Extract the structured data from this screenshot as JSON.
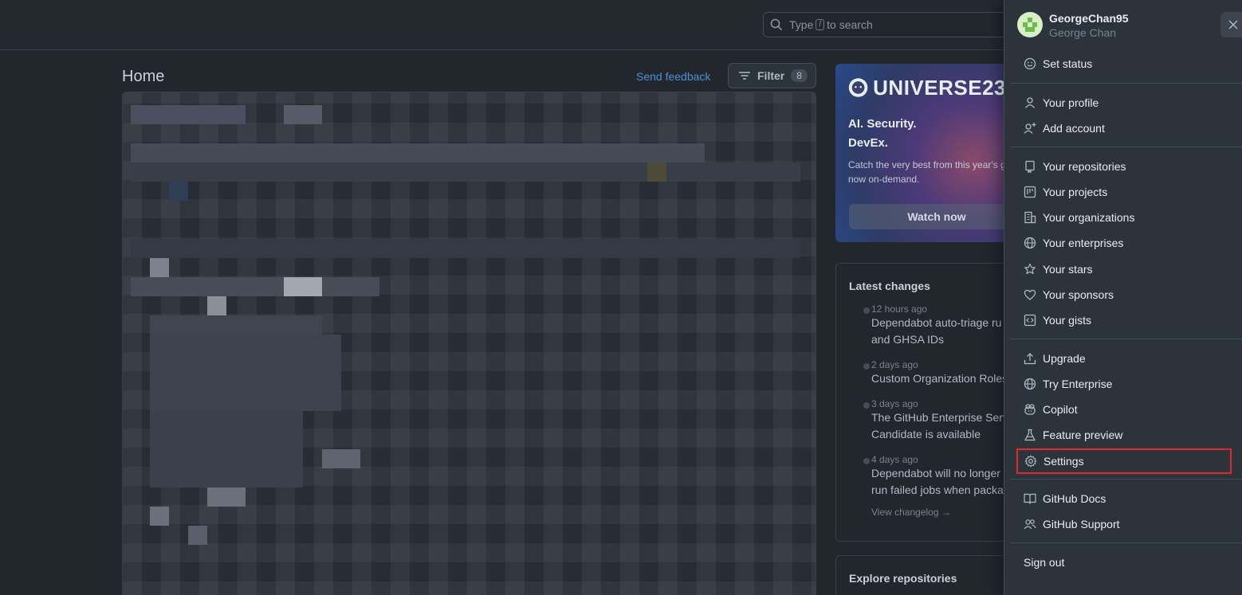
{
  "header": {
    "search_prefix": "Type",
    "search_key": "/",
    "search_suffix": "to search"
  },
  "main": {
    "title": "Home",
    "send_feedback": "Send feedback",
    "filter_label": "Filter",
    "filter_count": "8"
  },
  "promo": {
    "logo_text": "UNIVERSE23",
    "heading_line1": "AI. Security.",
    "heading_line2": "DevEx.",
    "body": "Catch the very best from this year's g now on-demand.",
    "button": "Watch now"
  },
  "latest_changes": {
    "title": "Latest changes",
    "items": [
      {
        "time": "12 hours ago",
        "line1": "Dependabot auto-triage ru",
        "line2": "and GHSA IDs"
      },
      {
        "time": "2 days ago",
        "line1": "Custom Organization Roles",
        "line2": ""
      },
      {
        "time": "3 days ago",
        "line1": "The GitHub Enterprise Serv",
        "line2": "Candidate is available"
      },
      {
        "time": "4 days ago",
        "line1": "Dependabot will no longer",
        "line2": "run failed jobs when packa"
      }
    ],
    "changelog_link": "View changelog →"
  },
  "explore": {
    "title": "Explore repositories"
  },
  "user_menu": {
    "username": "GeorgeChan95",
    "full_name": "George Chan",
    "items": {
      "set_status": "Set status",
      "your_profile": "Your profile",
      "add_account": "Add account",
      "your_repositories": "Your repositories",
      "your_projects": "Your projects",
      "your_organizations": "Your organizations",
      "your_enterprises": "Your enterprises",
      "your_stars": "Your stars",
      "your_sponsors": "Your sponsors",
      "your_gists": "Your gists",
      "upgrade": "Upgrade",
      "try_enterprise": "Try Enterprise",
      "copilot": "Copilot",
      "feature_preview": "Feature preview",
      "settings": "Settings",
      "github_docs": "GitHub Docs",
      "github_support": "GitHub Support",
      "sign_out": "Sign out"
    },
    "highlight_color": "#e5242b"
  }
}
